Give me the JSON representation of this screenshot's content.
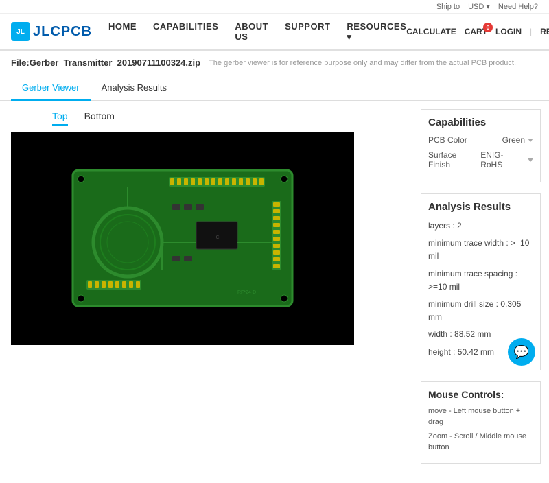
{
  "topBar": {
    "shipTo": "Ship to",
    "currency": "USD",
    "currencyArrow": "▾",
    "needHelp": "Need Help?"
  },
  "nav": {
    "logoText": "JLCPCB",
    "links": [
      {
        "label": "HOME",
        "id": "home"
      },
      {
        "label": "CAPABILITIES",
        "id": "capabilities"
      },
      {
        "label": "ABOUT US",
        "id": "about"
      },
      {
        "label": "SUPPORT",
        "id": "support"
      },
      {
        "label": "RESOURCES",
        "id": "resources",
        "hasArrow": true
      }
    ],
    "calculate": "CALCULATE",
    "cart": "CART",
    "cartCount": "0",
    "login": "LOGIN",
    "register": "REGISTER"
  },
  "fileInfo": {
    "fileName": "File:Gerber_Transmitter_20190711100324.zip",
    "note": "The gerber viewer is for reference purpose only and may differ from the actual PCB product."
  },
  "tabs": {
    "items": [
      {
        "label": "Gerber Viewer",
        "id": "gerber",
        "active": true
      },
      {
        "label": "Analysis Results",
        "id": "analysis",
        "active": false
      }
    ]
  },
  "viewTabs": {
    "top": "Top",
    "bottom": "Bottom"
  },
  "capabilities": {
    "title": "Capabilities",
    "items": [
      {
        "label": "PCB Color",
        "value": "Green"
      },
      {
        "label": "Surface Finish",
        "value": "ENIG-RoHS"
      }
    ]
  },
  "analysisResults": {
    "title": "Analysis Results",
    "items": [
      "layers : 2",
      "minimum trace width : >=10 mil",
      "minimum trace spacing : >=10 mil",
      "minimum drill size : 0.305 mm",
      "width : 88.52 mm",
      "height : 50.42 mm"
    ]
  },
  "mouseControls": {
    "title": "Mouse Controls:",
    "items": [
      "move - Left mouse button + drag",
      "Zoom - Scroll / Middle mouse button"
    ]
  },
  "chatButton": {
    "icon": "💬"
  }
}
